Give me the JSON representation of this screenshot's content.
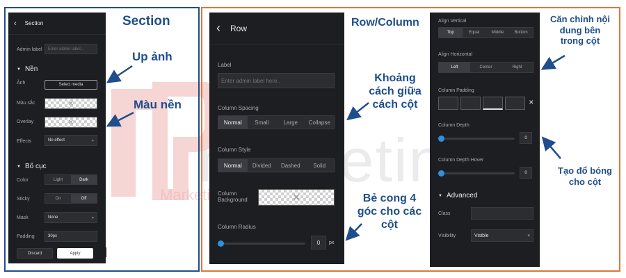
{
  "annotations": {
    "section_title": "Section",
    "upload_image": "Up ảnh",
    "background_color": "Màu nền",
    "row_column_title": "Row/Column",
    "column_spacing_note": [
      "Khoảng",
      "cách giữa",
      "cách cột"
    ],
    "radius_note": [
      "Bẻ cong 4",
      "góc cho các",
      "cột"
    ],
    "align_note": [
      "Căn chỉnh nội",
      "dung bên",
      "trong cột"
    ],
    "depth_note": [
      "Tạo đổ bóng",
      "cho cột"
    ]
  },
  "watermark": {
    "brand": "marketing",
    "sub": "Marketing"
  },
  "section_panel": {
    "back_icon": "chevron-left-icon",
    "title": "Section",
    "admin_label": "Admin label",
    "admin_placeholder": "Enter admin label...",
    "background_heading": "Nền",
    "image_label": "Ảnh",
    "select_media": "Select media",
    "color_label": "Màu sắc",
    "overlay_label": "Overlay",
    "effects_label": "Effects",
    "effects_value": "No effect",
    "layout_heading": "Bố cục",
    "color_mode_label": "Color",
    "color_modes": [
      "Light",
      "Dark"
    ],
    "color_mode_selected": "Dark",
    "sticky_label": "Sticky",
    "sticky_options": [
      "On",
      "Off"
    ],
    "sticky_selected": "Off",
    "mask_label": "Mask",
    "mask_value": "None",
    "padding_label": "Padding",
    "padding_value": "30px",
    "discard": "Discard",
    "apply": "Apply"
  },
  "row_panel": {
    "title": "Row",
    "label_heading": "Label",
    "label_placeholder": "Enter admin label here..",
    "spacing_heading": "Column Spacing",
    "spacing_options": [
      "Normal",
      "Small",
      "Large",
      "Collapse"
    ],
    "spacing_selected": "Normal",
    "style_heading": "Column Style",
    "style_options": [
      "Normal",
      "Divided",
      "Dashed",
      "Solid"
    ],
    "style_selected": "Normal",
    "background_label": [
      "Column",
      "Background"
    ],
    "radius_heading": "Column Radius",
    "radius_value": "0",
    "radius_unit": "px"
  },
  "column_panel": {
    "align_v_heading": "Align Vertical",
    "align_v_options": [
      "Top",
      "Equal",
      "Middle",
      "Bottom"
    ],
    "align_v_selected": "Top",
    "align_h_heading": "Align Horizontal",
    "align_h_options": [
      "Left",
      "Center",
      "Right"
    ],
    "align_h_selected": "Left",
    "padding_heading": "Column Padding",
    "depth_heading": "Column Depth",
    "depth_value": "0",
    "depth_hover_heading": "Column Depth Hover",
    "depth_hover_value": "0",
    "advanced_heading": "Advanced",
    "class_label": "Class",
    "visibility_label": "Visibility",
    "visibility_value": "Visible"
  },
  "colors": {
    "accent": "#2f8fe0",
    "annotation": "#1f4e8a",
    "frame_left": "#1f4e8a",
    "frame_right": "#d97a3a",
    "panel_bg": "#1d1e22"
  }
}
